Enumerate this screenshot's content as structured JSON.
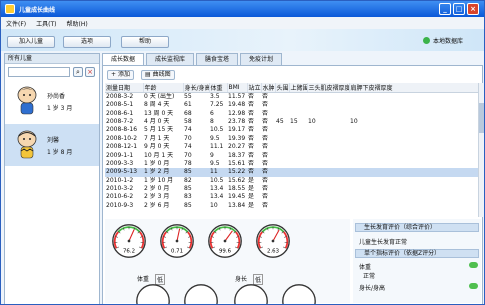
{
  "window": {
    "title": "儿童成长曲线"
  },
  "menu": [
    "文件(F)",
    "工具(T)",
    "帮助(H)"
  ],
  "toolbar": {
    "add_child": "加入儿童",
    "options": "选项",
    "help": "帮助",
    "local_db": "本地数据库"
  },
  "sidebar": {
    "header": "所有儿童",
    "children": [
      {
        "name": "孙尚香",
        "age": "1 岁 3 月"
      },
      {
        "name": "刘馨",
        "age": "1 岁 8 月"
      }
    ]
  },
  "tabs": [
    "成长数据",
    "成长监视库",
    "膳食宝塔",
    "免疫计划"
  ],
  "grid_toolbar": {
    "add": "添加",
    "curve": "曲线图"
  },
  "table": {
    "headers": [
      "测量日期",
      "年龄",
      "身长/身高",
      "体重",
      "BMI",
      "站立",
      "水肿",
      "头围",
      "上臂围",
      "三头肌皮褶厚度",
      "肩胛下皮褶厚度"
    ],
    "rows": [
      [
        "2008-3-2",
        "0 天 (出生)",
        "55",
        "3.5",
        "11.57",
        "否",
        "否",
        "",
        "",
        "",
        ""
      ],
      [
        "2008-5-1",
        "8 周 4 天",
        "61",
        "7.25",
        "19.48",
        "否",
        "否",
        "",
        "",
        "",
        ""
      ],
      [
        "2008-6-1",
        "13 周 0 天",
        "68",
        "6",
        "12.98",
        "否",
        "否",
        "",
        "",
        "",
        ""
      ],
      [
        "2008-7-2",
        "4 月 0 天",
        "58",
        "8",
        "23.78",
        "否",
        "否",
        "45",
        "15",
        "10",
        "10"
      ],
      [
        "2008-8-16",
        "5 月 15 天",
        "74",
        "10.5",
        "19.17",
        "否",
        "否",
        "",
        "",
        "",
        ""
      ],
      [
        "2008-10-2",
        "7 月 1 天",
        "70",
        "9.5",
        "19.39",
        "否",
        "否",
        "",
        "",
        "",
        ""
      ],
      [
        "2008-12-1",
        "9 月 0 天",
        "74",
        "11.1",
        "20.27",
        "否",
        "否",
        "",
        "",
        "",
        ""
      ],
      [
        "2009-1-1",
        "10 月 1 天",
        "70",
        "9",
        "18.37",
        "否",
        "否",
        "",
        "",
        "",
        ""
      ],
      [
        "2009-3-3",
        "1 岁 0 月",
        "78",
        "9.5",
        "15.61",
        "否",
        "否",
        "",
        "",
        "",
        ""
      ],
      [
        "2009-5-13",
        "1 岁 2 月",
        "85",
        "11",
        "15.22",
        "否",
        "否",
        "",
        "",
        "",
        ""
      ],
      [
        "2010-1-2",
        "1 岁 10 月",
        "82",
        "10.5",
        "15.62",
        "是",
        "否",
        "",
        "",
        "",
        ""
      ],
      [
        "2010-3-2",
        "2 岁 0 月",
        "85",
        "13.4",
        "18.55",
        "是",
        "否",
        "",
        "",
        "",
        ""
      ],
      [
        "2010-6-2",
        "2 岁 3 月",
        "83",
        "13.4",
        "19.45",
        "是",
        "否",
        "",
        "",
        "",
        ""
      ],
      [
        "2010-9-3",
        "2 岁 6 月",
        "85",
        "10",
        "13.84",
        "是",
        "否",
        "",
        "",
        "",
        ""
      ]
    ],
    "selected_row": 9
  },
  "gauges": [
    {
      "value": "76.2",
      "level": 0.6
    },
    {
      "value": "0.71",
      "level": 0.55
    },
    {
      "value": "99.6",
      "level": 0.65
    },
    {
      "value": "2.63",
      "level": 0.62
    }
  ],
  "gauge_labels": {
    "weight": "体重",
    "weight_note": "低",
    "height": "身长",
    "height_note": "低"
  },
  "evaluation": {
    "head1": "生长发育评价（综合评价）",
    "text1": "儿童生长发育正常",
    "head2": "单个指标评价（依据Z评分）",
    "items": [
      {
        "label": "体重",
        "value": "正常"
      },
      {
        "label": "身长/身高",
        "value": ""
      }
    ]
  },
  "colors": {
    "title_bar": "#0b58d8",
    "selected_row": "#c5d9f1",
    "ok": "#4fbf4f"
  }
}
